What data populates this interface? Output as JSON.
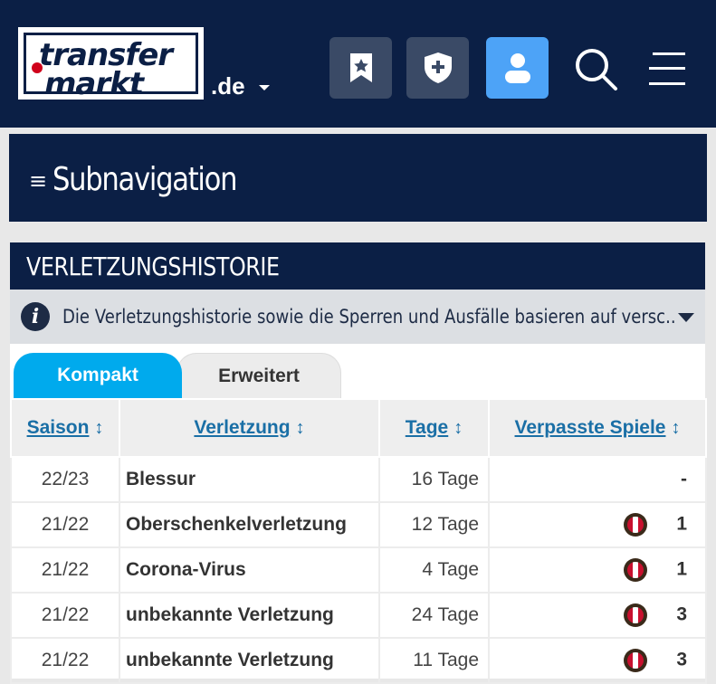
{
  "header": {
    "logo_line1": "transfer",
    "logo_line2": "markt",
    "domain": ".de",
    "buttons": [
      {
        "icon": "bookmark-star-icon"
      },
      {
        "icon": "shield-plus-icon"
      },
      {
        "icon": "user-icon",
        "active": true
      },
      {
        "icon": "search-icon"
      },
      {
        "icon": "menu-icon"
      }
    ]
  },
  "subnav": {
    "icon": "≡",
    "label": "Subnavigation"
  },
  "box": {
    "title": "VERLETZUNGSHISTORIE",
    "info_text": "Die Verletzungshistorie sowie die Sperren und Ausfälle basieren auf versc..",
    "tabs": [
      "Kompakt",
      "Erweitert"
    ],
    "columns": [
      "Saison",
      "Verletzung",
      "Tage",
      "Verpasste Spiele"
    ],
    "rows": [
      {
        "season": "22/23",
        "injury": "Blessur",
        "days": "16 Tage",
        "games": "-",
        "club": false
      },
      {
        "season": "21/22",
        "injury": "Oberschenkelverletzung",
        "days": "12 Tage",
        "games": "1",
        "club": true
      },
      {
        "season": "21/22",
        "injury": "Corona-Virus",
        "days": "4 Tage",
        "games": "1",
        "club": true
      },
      {
        "season": "21/22",
        "injury": "unbekannte Verletzung",
        "days": "24 Tage",
        "games": "3",
        "club": true
      },
      {
        "season": "21/22",
        "injury": "unbekannte Verletzung",
        "days": "11 Tage",
        "games": "3",
        "club": true
      }
    ]
  },
  "colors": {
    "navy": "#0b1f45",
    "accent_blue": "#00aaed",
    "active_button": "#4da3f7",
    "link": "#1a6fa6"
  }
}
